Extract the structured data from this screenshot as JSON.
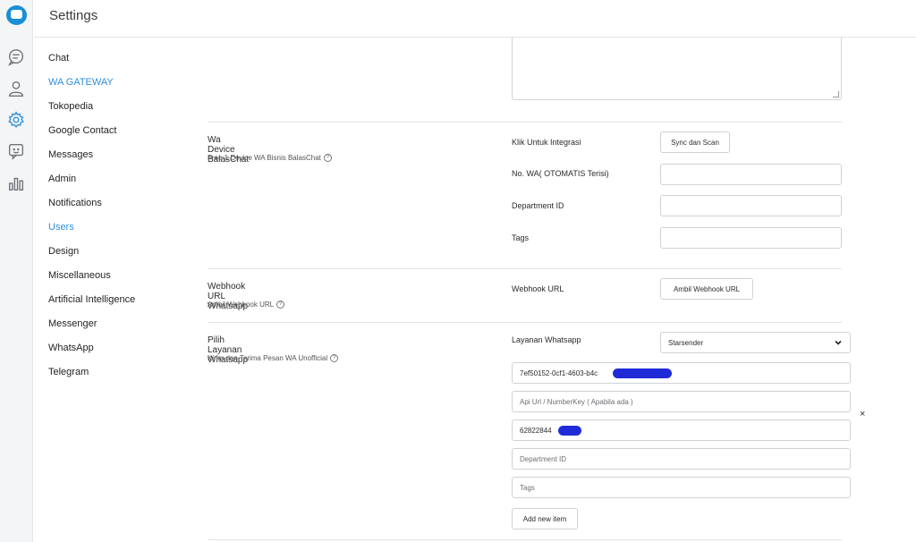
{
  "header": {
    "title": "Settings"
  },
  "rail": {
    "icons": [
      "chat-bubble-icon",
      "user-icon",
      "gear-icon",
      "feedback-icon",
      "bar-chart-icon"
    ],
    "active_color": "#2f8ed9",
    "brand_color": "#1a8fd6"
  },
  "nav": {
    "items": [
      {
        "label": "Chat"
      },
      {
        "label": "WA GATEWAY"
      },
      {
        "label": "Tokopedia"
      },
      {
        "label": "Google Contact"
      },
      {
        "label": "Messages"
      },
      {
        "label": "Admin"
      },
      {
        "label": "Notifications"
      },
      {
        "label": "Users"
      },
      {
        "label": "Design"
      },
      {
        "label": "Miscellaneous"
      },
      {
        "label": "Artificial Intelligence"
      },
      {
        "label": "Messenger"
      },
      {
        "label": "WhatsApp"
      },
      {
        "label": "Telegram"
      }
    ]
  },
  "device": {
    "title": "Wa Device BalasChat",
    "subtitle": "Free 1 Device WA Bisnis BalasChat",
    "integrate_label": "Klik Untuk Integrasi",
    "sync_button": "Sync dan Scan",
    "wa_label": "No. WA( OTOMATIS Terisi)",
    "wa_value": "",
    "dept_label": "Department ID",
    "dept_value": "",
    "tags_label": "Tags",
    "tags_value": ""
  },
  "webhook": {
    "title": "Webhook URL Whatsapp",
    "subtitle": "Ambil Webhook URL",
    "label": "Webhook URL",
    "button": "Ambil Webhook URL"
  },
  "service": {
    "title": "Pilih Layanan Whatsapp",
    "subtitle": "Kirim dan Terima Pesan WA Unofficial",
    "label": "Layanan Whatsapp",
    "selected": "Starsender",
    "api_key_value": "7ef50152-0cf1-4603-b4c",
    "api_url_placeholder": "Api Url / NumberKey ( Apabila ada )",
    "number_value": "62822844",
    "dept_placeholder": "Department ID",
    "tags_placeholder": "Tags",
    "add_button": "Add new item",
    "close_symbol": "×",
    "redaction_color": "#1f2bd6"
  }
}
